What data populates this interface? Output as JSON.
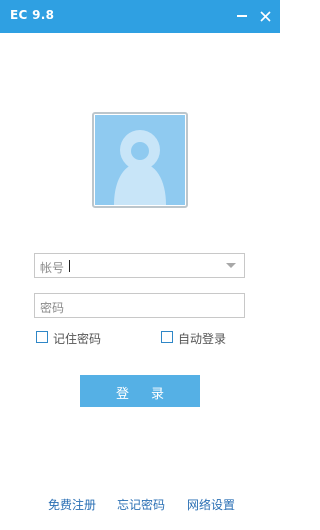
{
  "window": {
    "title": "EC 9.8",
    "titlebar_color": "#2fa0e2",
    "icons": {
      "minimize": "minimize-icon",
      "close": "close-icon"
    }
  },
  "avatar": {
    "icon": "user-avatar-icon",
    "bg_color": "#8fcaf0",
    "figure_color": "#c8e5f8"
  },
  "login_form": {
    "account": {
      "placeholder": "帐号",
      "value": "",
      "icon": "chevron-down-icon"
    },
    "password": {
      "placeholder": "密码",
      "value": ""
    },
    "remember_password": {
      "label": "记住密码",
      "checked": false
    },
    "auto_login": {
      "label": "自动登录",
      "checked": false
    },
    "login_button": {
      "label": "登录",
      "color": "#55b0e5"
    }
  },
  "footer": {
    "register": "免费注册",
    "forgot_password": "忘记密码",
    "network_settings": "网络设置",
    "link_color": "#2a6fb4"
  }
}
